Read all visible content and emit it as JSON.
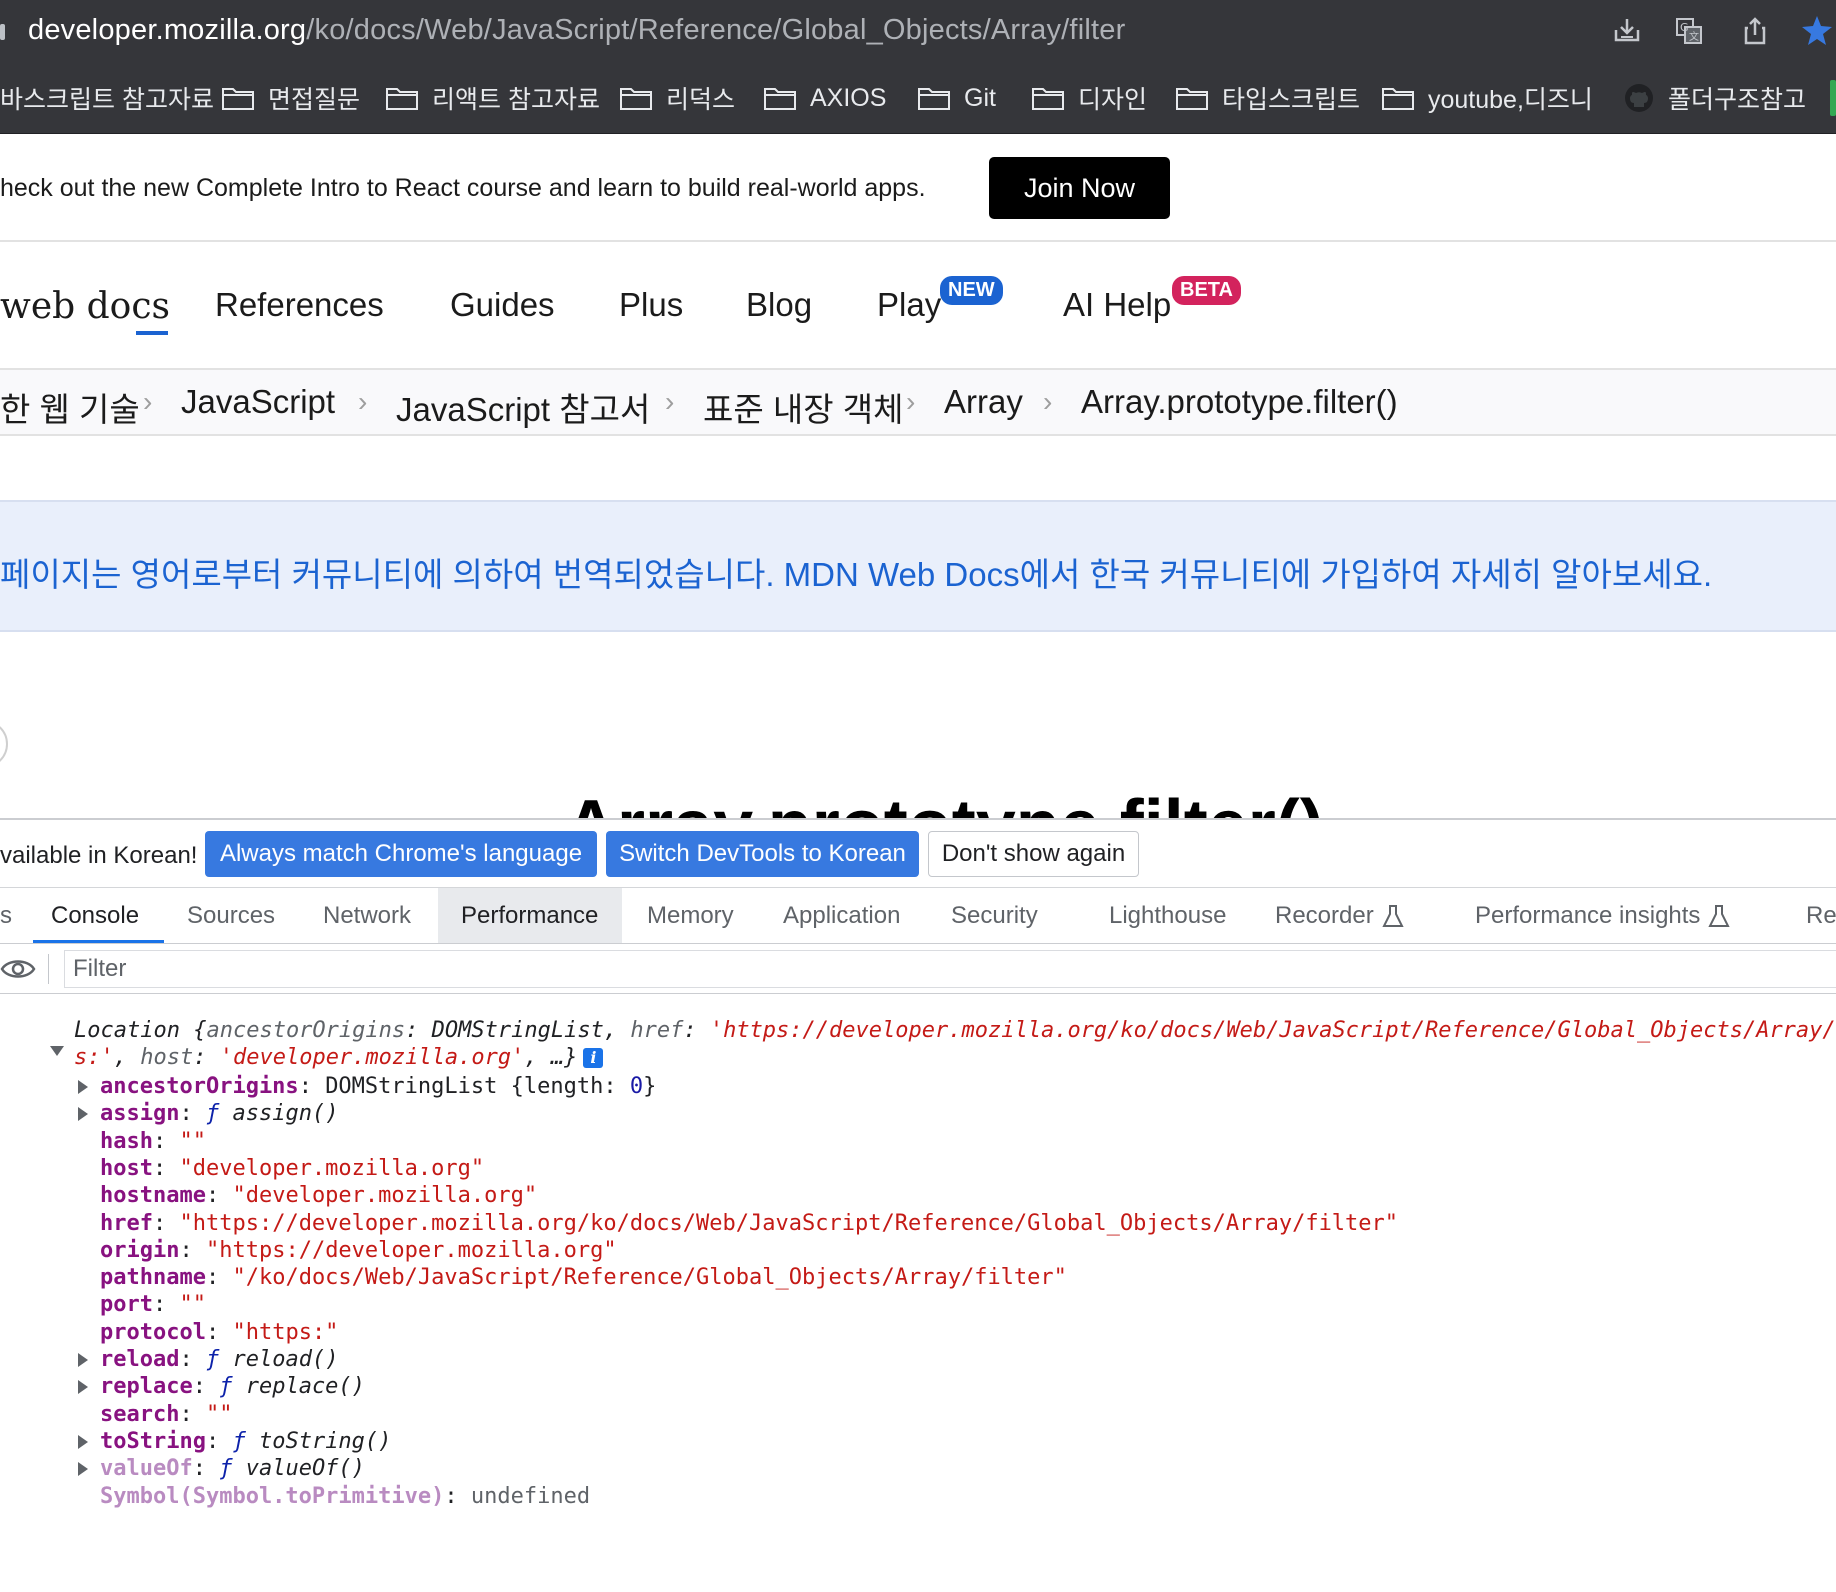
{
  "browser": {
    "url_host": "developer.mozilla.org",
    "url_path": "/ko/docs/Web/JavaScript/Reference/Global_Objects/Array/filter",
    "icons": [
      "download-icon",
      "translate-icon",
      "share-icon",
      "bookmark-star-icon"
    ],
    "accent_color": "#3779e0"
  },
  "bookmarks": [
    {
      "label": "바스크립트 참고자료",
      "icon": "none"
    },
    {
      "label": "면접질문",
      "icon": "folder-icon"
    },
    {
      "label": "리액트 참고자료",
      "icon": "folder-icon"
    },
    {
      "label": "리덕스",
      "icon": "folder-icon"
    },
    {
      "label": "AXIOS",
      "icon": "folder-icon"
    },
    {
      "label": "Git",
      "icon": "folder-icon"
    },
    {
      "label": "디자인",
      "icon": "folder-icon"
    },
    {
      "label": "타입스크립트",
      "icon": "folder-icon"
    },
    {
      "label": "youtube,디즈니",
      "icon": "folder-icon"
    },
    {
      "label": "폴더구조참고",
      "icon": "github-icon"
    }
  ],
  "promo": {
    "text": "heck out the new Complete Intro to React course and learn to build real-world apps.",
    "button": "Join Now"
  },
  "nav": {
    "logo": "web docs",
    "items": [
      "References",
      "Guides",
      "Plus",
      "Blog",
      "Play",
      "AI Help"
    ],
    "badge_new": "NEW",
    "badge_beta": "BETA"
  },
  "breadcrumb": [
    "한 웹 기술",
    "JavaScript",
    "JavaScript 참고서",
    "표준 내장 객체",
    "Array",
    "Array.prototype.filter()"
  ],
  "notice": {
    "text": "페이지는 영어로부터 커뮤니티에 의하여 번역되었습니다. MDN Web Docs에서 한국 커뮤니티에 가입하여 자세히 알아보세요."
  },
  "heading_peek": "Array.prototype.filter()",
  "devtools": {
    "lang_bar": {
      "text": "vailable in Korean!",
      "btn_match": "Always match Chrome's language",
      "btn_switch": "Switch DevTools to Korean",
      "btn_dont": "Don't show again"
    },
    "tabs": [
      "s",
      "Console",
      "Sources",
      "Network",
      "Performance",
      "Memory",
      "Application",
      "Security",
      "Lighthouse",
      "Recorder",
      "Performance insights",
      "Re"
    ],
    "filter_placeholder": "Filter",
    "console": {
      "line1_prefix": "Location ",
      "line1_a": "{",
      "line1_key1": "ancestorOrigins",
      "line1_val1": "DOMStringList",
      "line1_key2": "href",
      "line1_val2": "'https://developer.mozilla.org/ko/docs/Web/JavaScript/Reference/Global_Objects/Array/",
      "line2_val": "s:'",
      "line2_key": "host",
      "line2_host": "'developer.mozilla.org'",
      "line2_end": ", …}",
      "info": "i",
      "props": [
        {
          "key": "ancestorOrigins",
          "sep": ": ",
          "val": "DOMStringList {length: ",
          "num": "0",
          "tail": "}",
          "kind": "object",
          "expandable": true
        },
        {
          "key": "assign",
          "sep": ": ",
          "f": "ƒ",
          "val": " assign()",
          "kind": "fn",
          "expandable": true
        },
        {
          "key": "hash",
          "sep": ": ",
          "val": "\"\"",
          "kind": "str",
          "expandable": false
        },
        {
          "key": "host",
          "sep": ": ",
          "val": "\"developer.mozilla.org\"",
          "kind": "str",
          "expandable": false
        },
        {
          "key": "hostname",
          "sep": ": ",
          "val": "\"developer.mozilla.org\"",
          "kind": "str",
          "expandable": false
        },
        {
          "key": "href",
          "sep": ": ",
          "val": "\"https://developer.mozilla.org/ko/docs/Web/JavaScript/Reference/Global_Objects/Array/filter\"",
          "kind": "str",
          "expandable": false
        },
        {
          "key": "origin",
          "sep": ": ",
          "val": "\"https://developer.mozilla.org\"",
          "kind": "str",
          "expandable": false
        },
        {
          "key": "pathname",
          "sep": ": ",
          "val": "\"/ko/docs/Web/JavaScript/Reference/Global_Objects/Array/filter\"",
          "kind": "str",
          "expandable": false
        },
        {
          "key": "port",
          "sep": ": ",
          "val": "\"\"",
          "kind": "str",
          "expandable": false
        },
        {
          "key": "protocol",
          "sep": ": ",
          "val": "\"https:\"",
          "kind": "str",
          "expandable": false
        },
        {
          "key": "reload",
          "sep": ": ",
          "f": "ƒ",
          "val": " reload()",
          "kind": "fn",
          "expandable": true
        },
        {
          "key": "replace",
          "sep": ": ",
          "f": "ƒ",
          "val": " replace()",
          "kind": "fn",
          "expandable": true
        },
        {
          "key": "search",
          "sep": ": ",
          "val": "\"\"",
          "kind": "str",
          "expandable": false
        },
        {
          "key": "toString",
          "sep": ": ",
          "f": "ƒ",
          "val": " toString()",
          "kind": "fn",
          "expandable": true
        },
        {
          "key": "valueOf",
          "sep": ": ",
          "f": "ƒ",
          "val": " valueOf()",
          "kind": "fn",
          "expandable": true
        },
        {
          "key": "Symbol(Symbol.toPrimitive)",
          "sep": ": ",
          "val": "undefined",
          "kind": "undef",
          "expandable": false
        }
      ]
    }
  }
}
